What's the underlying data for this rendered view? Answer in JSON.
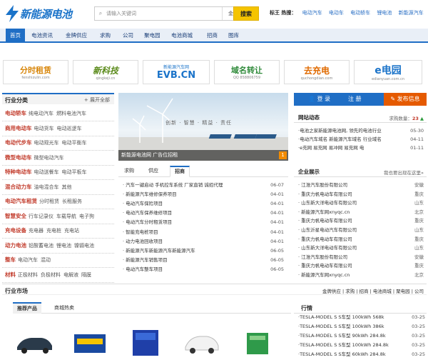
{
  "site": {
    "title": "新能源电池"
  },
  "search": {
    "placeholder": "请输入关键词",
    "category": "金牌供应",
    "button": "搜索"
  },
  "hot": {
    "label": "标王 热搜：",
    "terms": [
      "电动汽车",
      "电动车",
      "电动轿车",
      "锂电池",
      "新能源汽车",
      "电"
    ]
  },
  "nav": [
    "首页",
    "电池资讯",
    "金牌供应",
    "求购",
    "公司",
    "聚电园",
    "电池商城",
    "招商",
    "图库"
  ],
  "logos": [
    {
      "label": "分时租赁",
      "sub": "fenshizulin.com",
      "color": "#d8860a"
    },
    {
      "label": "新科技",
      "sub": "qingkeji.cn",
      "color": "#5a8a1a"
    },
    {
      "label": "EVB.CN",
      "sub": "新能源汽车网",
      "color": "#1a73c9"
    },
    {
      "label": "域名转让",
      "sub": "QQ 858806759",
      "color": "#2f8a3a"
    },
    {
      "label": "去充电",
      "sub": "quchongdian.com",
      "color": "#e06a00"
    },
    {
      "label": "e电园",
      "sub": "edianyuan.com.cn",
      "color": "#1a73c9"
    }
  ],
  "sidebar": {
    "title": "行业分类",
    "expand": "展开全部",
    "rows": [
      {
        "name": "电动轿车",
        "subs": [
          "纯电动汽车",
          "燃料电池汽车"
        ]
      },
      {
        "name": "商用电动车",
        "subs": [
          "电动货车",
          "电动巡逻车"
        ]
      },
      {
        "name": "电动代步车",
        "subs": [
          "电动观光车",
          "电动平衡车"
        ]
      },
      {
        "name": "微型电动车",
        "subs": [
          "微型电动汽车"
        ]
      },
      {
        "name": "特种电动车",
        "subs": [
          "电动送餐车",
          "电动平板车"
        ]
      },
      {
        "name": "混合动力车",
        "subs": [
          "油电混合车",
          "其他"
        ]
      },
      {
        "name": "电动汽车租赁",
        "subs": [
          "分时租赁",
          "长租服务"
        ]
      },
      {
        "name": "智慧安全",
        "subs": [
          "行车记录仪",
          "车载导航",
          "电子狗"
        ]
      },
      {
        "name": "充电设备",
        "subs": [
          "充电器",
          "充电桩",
          "充电站"
        ]
      },
      {
        "name": "动力电池",
        "subs": [
          "铅酸蓄电池",
          "锂电池",
          "镍镉电池"
        ]
      },
      {
        "name": "整车",
        "subs": [
          "电动汽车",
          "混动"
        ]
      },
      {
        "name": "材料",
        "subs": [
          "正极材料",
          "负极材料",
          "电解液",
          "隔膜"
        ]
      }
    ]
  },
  "banner": {
    "caption": "新能源电池网 广告位招租",
    "slogan": "创新 · 智慧 · 精益 · 责任",
    "num": "1"
  },
  "newsTabs": [
    "求购",
    "供应",
    "招商"
  ],
  "news": [
    {
      "t": "汽车一键启动 手机控车系统 厂家直销 诚招代理",
      "d": "06-07"
    },
    {
      "t": "新能源汽车维修保养项目",
      "d": "04-01"
    },
    {
      "t": "电动汽车保险项目",
      "d": "04-01"
    },
    {
      "t": "电动汽车保养维修项目",
      "d": "04-01"
    },
    {
      "t": "电动汽车分时租赁项目",
      "d": "04-01"
    },
    {
      "t": "智能充电桩项目",
      "d": "04-01"
    },
    {
      "t": "动力电池回收项目",
      "d": "04-01"
    },
    {
      "t": "新能源汽车新能源汽车新能源汽车",
      "d": "06-05"
    },
    {
      "t": "新能源汽车销售项目",
      "d": "06-05"
    },
    {
      "t": "电动汽车整车项目",
      "d": "06-05"
    }
  ],
  "login": {
    "login": "登 录",
    "register": "注 册",
    "publish": "发布信息"
  },
  "dynamic": {
    "title": "网站动态",
    "meta": "求购数量：",
    "count": "23",
    "rows": [
      {
        "t": "·电池之家新能源电池网, 领先的电池行业",
        "d": "05-30"
      },
      {
        "t": "·电动汽车域名 新能源汽车域名 行业域名",
        "d": "04-11"
      },
      {
        "t": "·e充网 易充网 易冲网 易充网 电",
        "d": "01-11"
      }
    ]
  },
  "enterprise": {
    "title": "企业展示",
    "meta": "我也要出现在这里»",
    "rows": [
      {
        "n": "江淮汽车股份有限公司",
        "c": "安徽"
      },
      {
        "n": "重庆力帆电动车有限公司",
        "c": "重庆"
      },
      {
        "n": "山东新大洋电动车有限公司",
        "c": "山东"
      },
      {
        "n": "新能源汽车网xnyqc.cn",
        "c": "北京"
      },
      {
        "n": "重庆力帆电动车有限公司",
        "c": "重庆"
      },
      {
        "n": "山东沂星电动汽车有限公司",
        "c": "山东"
      },
      {
        "n": "重庆力帆电动车有限公司",
        "c": "重庆"
      },
      {
        "n": "山东新大洋电动车有限公司",
        "c": "山东"
      },
      {
        "n": "江淮汽车股份有限公司",
        "c": "安徽"
      },
      {
        "n": "重庆力帆电动车有限公司",
        "c": "重庆"
      },
      {
        "n": "新能源汽车网xnyqc.cn",
        "c": "北京"
      }
    ]
  },
  "market": {
    "title": "行业市场",
    "links": "金牌供应 | 求购 | 招商 | 电池商城 | 聚电园 | 公司"
  },
  "productTabs": [
    "推荐产品",
    "商城热卖"
  ],
  "quote": {
    "title": "行情",
    "rows": [
      {
        "t": "·TESLA-MODEL S S车型 100kWh 568k",
        "d": "03-25"
      },
      {
        "t": "·TESLA-MODEL S S车型 100kWh 386k",
        "d": "03-25"
      },
      {
        "t": "·TESLA-MODEL S S车型 90kWh 284.8k",
        "d": "03-25"
      },
      {
        "t": "·TESLA-MODEL S S车型 100kWh 284.8k",
        "d": "03-25"
      },
      {
        "t": "·TESLA-MODEL S S车型 60kWh 284.8k",
        "d": "03-25"
      }
    ]
  }
}
